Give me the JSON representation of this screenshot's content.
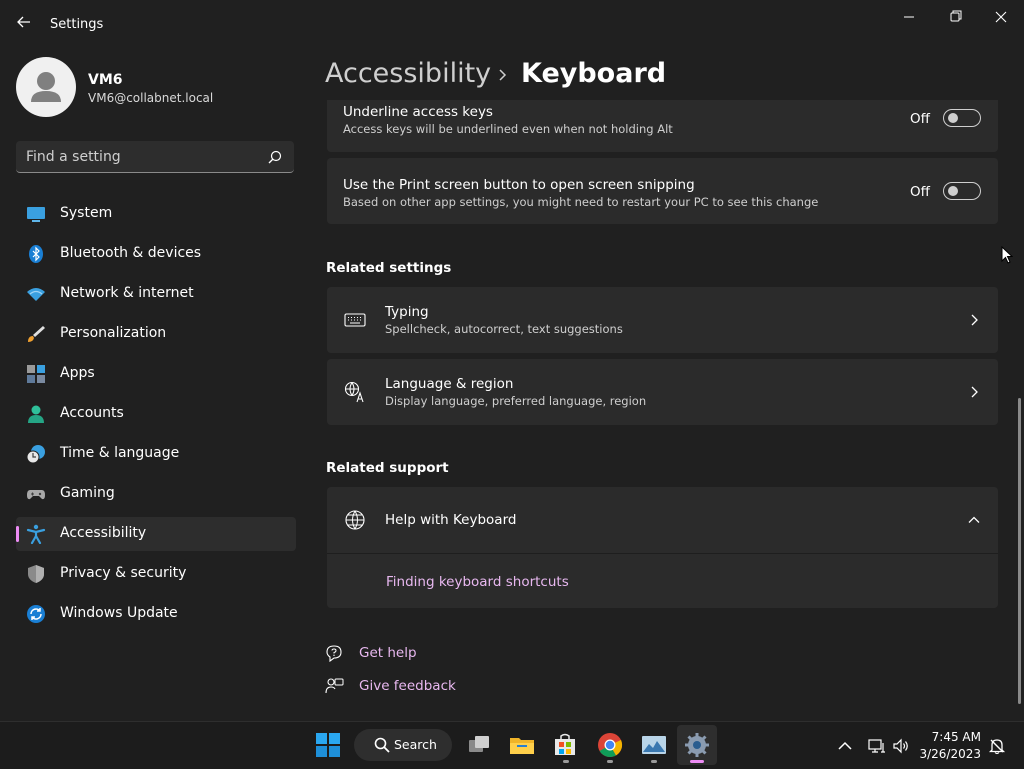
{
  "window": {
    "title": "Settings",
    "icons": {
      "back": "back-arrow-icon",
      "minimize": "minimize-icon",
      "maximize": "restore-icon",
      "close": "close-icon"
    }
  },
  "profile": {
    "name": "VM6",
    "email": "VM6@collabnet.local"
  },
  "search": {
    "placeholder": "Find a setting",
    "icon": "search-icon"
  },
  "sidebar": {
    "items": [
      {
        "label": "System",
        "icon": "system-icon",
        "active": false
      },
      {
        "label": "Bluetooth & devices",
        "icon": "bluetooth-icon",
        "active": false
      },
      {
        "label": "Network & internet",
        "icon": "wifi-icon",
        "active": false
      },
      {
        "label": "Personalization",
        "icon": "brush-icon",
        "active": false
      },
      {
        "label": "Apps",
        "icon": "apps-icon",
        "active": false
      },
      {
        "label": "Accounts",
        "icon": "account-icon",
        "active": false
      },
      {
        "label": "Time & language",
        "icon": "clock-globe-icon",
        "active": false
      },
      {
        "label": "Gaming",
        "icon": "gamepad-icon",
        "active": false
      },
      {
        "label": "Accessibility",
        "icon": "accessibility-icon",
        "active": true
      },
      {
        "label": "Privacy & security",
        "icon": "shield-icon",
        "active": false
      },
      {
        "label": "Windows Update",
        "icon": "update-icon",
        "active": false
      }
    ]
  },
  "main": {
    "breadcrumb": {
      "parent": "Accessibility",
      "current": "Keyboard"
    },
    "settings": [
      {
        "title": "Underline access keys",
        "subtitle": "Access keys will be underlined even when not holding Alt",
        "state": "Off"
      },
      {
        "title": "Use the Print screen button to open screen snipping",
        "subtitle": "Based on other app settings, you might need to restart your PC to see this change",
        "state": "Off"
      }
    ],
    "related_settings": {
      "title": "Related settings",
      "items": [
        {
          "title": "Typing",
          "subtitle": "Spellcheck, autocorrect, text suggestions",
          "icon": "keyboard-icon"
        },
        {
          "title": "Language & region",
          "subtitle": "Display language, preferred language, region",
          "icon": "language-icon"
        }
      ]
    },
    "related_support": {
      "title": "Related support",
      "help": {
        "title": "Help with Keyboard",
        "icon": "globe-icon",
        "link": "Finding keyboard shortcuts"
      }
    },
    "footer_links": [
      {
        "label": "Get help",
        "icon": "help-chat-icon"
      },
      {
        "label": "Give feedback",
        "icon": "feedback-icon"
      }
    ]
  },
  "taskbar": {
    "search_label": "Search",
    "time": "7:45 AM",
    "date": "3/26/2023",
    "apps": [
      "windows-start-icon",
      "task-view-icon",
      "file-explorer-icon",
      "microsoft-store-icon",
      "chrome-icon",
      "image-viewer-icon",
      "settings-gear-icon"
    ]
  },
  "colors": {
    "accent": "#ed8cf5",
    "link": "#e8b8f0",
    "background": "#202020",
    "card": "#2b2b2b"
  }
}
